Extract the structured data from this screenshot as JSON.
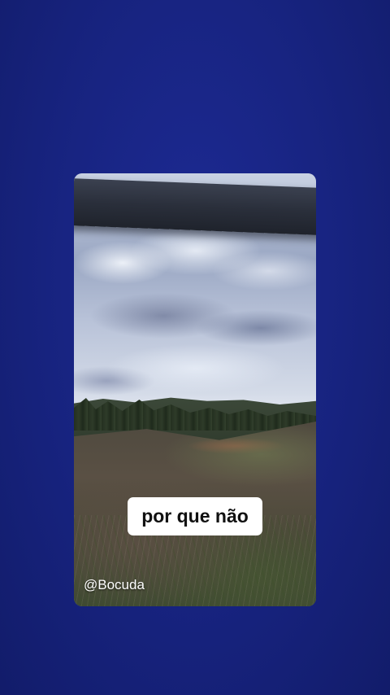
{
  "background_color": "#17237f",
  "story": {
    "caption": "por que não",
    "watermark": "@Bocuda",
    "caption_bg_color": "#ffffff",
    "caption_text_color": "#111111"
  }
}
